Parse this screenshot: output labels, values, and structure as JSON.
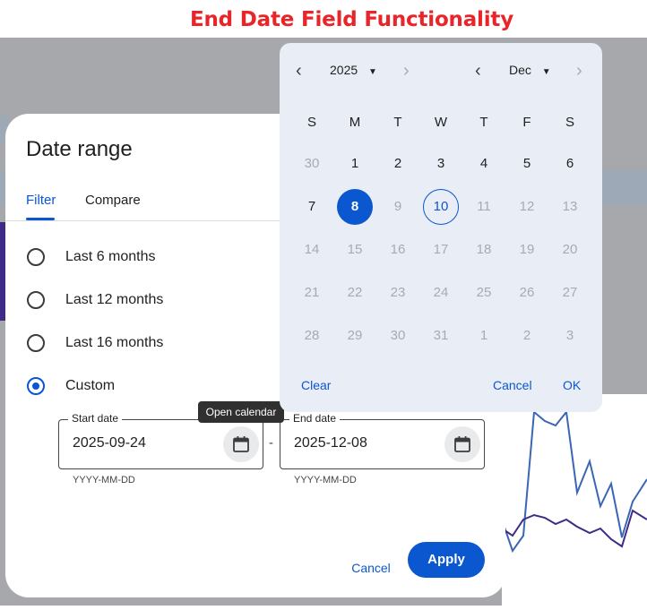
{
  "caption": "End Date Field Functionality",
  "dialog": {
    "title": "Date range",
    "tabs": {
      "filter": "Filter",
      "compare": "Compare"
    },
    "options": [
      "Last 6 months",
      "Last 12 months",
      "Last 16 months",
      "Custom"
    ],
    "selected_option": "Custom",
    "start_date": {
      "label": "Start date",
      "value": "2025-09-24",
      "hint": "YYYY-MM-DD"
    },
    "end_date": {
      "label": "End date",
      "value": "2025-12-08",
      "hint": "YYYY-MM-DD"
    },
    "separator": "-",
    "tooltip": "Open calendar",
    "cancel": "Cancel",
    "apply": "Apply"
  },
  "calendar": {
    "year": "2025",
    "month": "Dec",
    "weekdays": [
      "S",
      "M",
      "T",
      "W",
      "T",
      "F",
      "S"
    ],
    "weeks": [
      [
        "30",
        "1",
        "2",
        "3",
        "4",
        "5",
        "6"
      ],
      [
        "7",
        "8",
        "9",
        "10",
        "11",
        "12",
        "13"
      ],
      [
        "14",
        "15",
        "16",
        "17",
        "18",
        "19",
        "20"
      ],
      [
        "21",
        "22",
        "23",
        "24",
        "25",
        "26",
        "27"
      ],
      [
        "28",
        "29",
        "30",
        "31",
        "1",
        "2",
        "3"
      ]
    ],
    "selected_day": "8",
    "today_day": "10",
    "clear": "Clear",
    "cancel": "Cancel",
    "ok": "OK"
  },
  "colors": {
    "accent": "#0b57d0",
    "caption": "#e8262a",
    "popup_bg": "#e9edf6"
  }
}
